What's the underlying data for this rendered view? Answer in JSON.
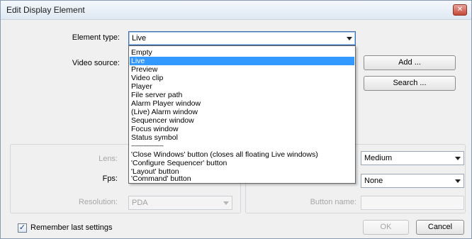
{
  "window": {
    "title": "Edit Display Element",
    "close_glyph": "✕"
  },
  "form": {
    "element_type_label": "Element type:",
    "element_type_value": "Live",
    "video_source_label": "Video source:",
    "lens_label": "Lens:",
    "fps_label": "Fps:",
    "resolution_label": "Resolution:",
    "resolution_value": "PDA",
    "right_combo_1_value": "Medium",
    "right_combo_2_value": "None",
    "button_name_label": "Button name:"
  },
  "buttons": {
    "add": "Add ...",
    "search": "Search ...",
    "ok": "OK",
    "cancel": "Cancel"
  },
  "remember": {
    "label": "Remember last settings",
    "checked_glyph": "✓"
  },
  "dropdown": {
    "options_top": [
      "Empty",
      "Live",
      "Preview",
      "Video clip",
      "Player",
      "File server path",
      "Alarm Player window",
      "(Live) Alarm window",
      "Sequencer window",
      "Focus window",
      "Status symbol"
    ],
    "separator": "---------------------",
    "options_bottom": [
      "'Close Windows' button (closes all floating Live windows)",
      "'Configure Sequencer' button",
      "'Layout' button",
      "'Command' button"
    ]
  }
}
